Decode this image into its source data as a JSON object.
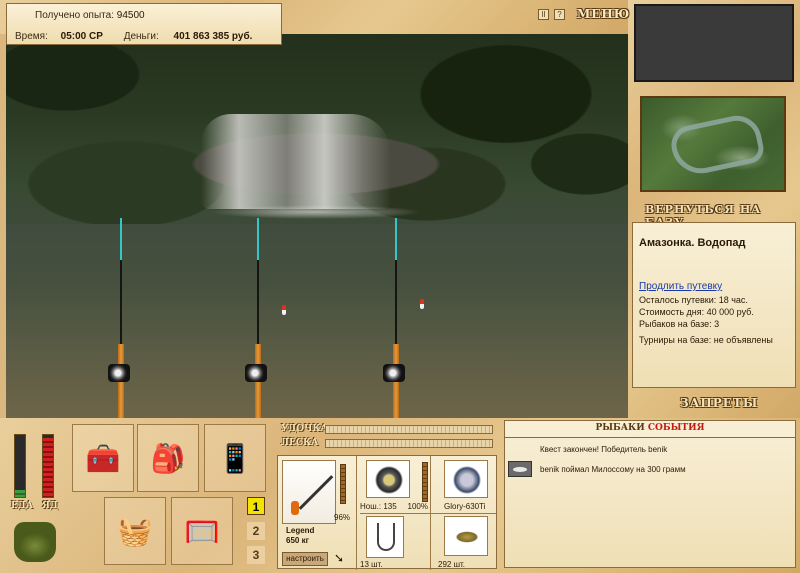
{
  "header": {
    "xp_label": "Получено опыта:",
    "xp_value": "94500",
    "time_label": "Время:",
    "time_value": "05:00 СР",
    "money_label": "Деньги:",
    "money_value": "401 863 385 руб.",
    "pause_label": "II",
    "help_label": "?",
    "menu_label": "МЕНЮ"
  },
  "sidebar": {
    "return_label": "ВЕРНУТЬСЯ НА БАЗУ",
    "location_title": "Амазонка. Водопад",
    "extend_link": "Продлить путевку",
    "lines": [
      "Осталось путевки: 18 час.",
      "Стоимость дня: 40 000 руб.",
      "Рыбаков на базе: 3"
    ],
    "tournaments": "Турниры на базе: не объявлены",
    "bans_label": "ЗАПРЕТЫ"
  },
  "meters": {
    "food_label": "ЕДА",
    "bait_label": "ЯД",
    "food_level": 0.12,
    "bait_level": 0.95
  },
  "slots": {
    "numbers": [
      "1",
      "2",
      "3"
    ],
    "active": "1"
  },
  "rod_status": {
    "rod_label": "УДОЧКА",
    "line_label": "ЛЕСКА"
  },
  "gear": {
    "rod_wear_pct": "96%",
    "rod_name": "Legend",
    "rod_weight": "650 кг",
    "setup_label": "настроить",
    "reel_info": "Нош.: 135",
    "reel_pct": "100%",
    "line_name": "Glory-630Ti",
    "hook_count": "13 шт.",
    "bait_count": "292 шт."
  },
  "events": {
    "title_a": "РЫБАКИ",
    "title_b": "СОБЫТИЯ",
    "items": [
      {
        "text": "Квест закончен! Победитель benik",
        "icon": "none"
      },
      {
        "text": "benik поймал Милоссому на 300 грамм",
        "icon": "fish-icon"
      }
    ]
  },
  "colors": {
    "accent_red": "#c41a10",
    "active_slot": "#f2e400",
    "rod_tip": "#36c6c8",
    "link": "#1a3aa8"
  }
}
